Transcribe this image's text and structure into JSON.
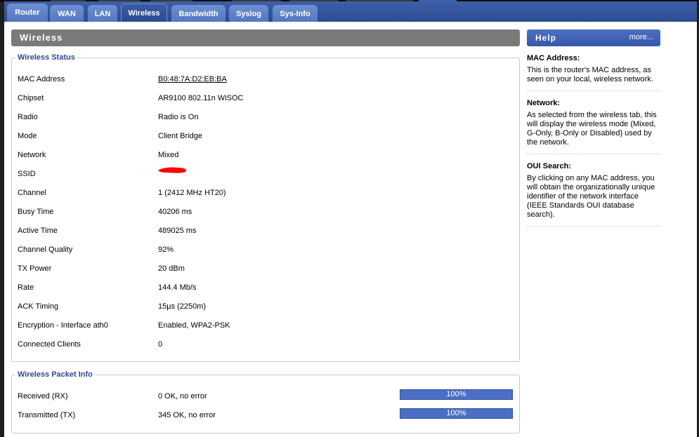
{
  "tabs": [
    {
      "label": "Router"
    },
    {
      "label": "WAN"
    },
    {
      "label": "LAN"
    },
    {
      "label": "Wireless"
    },
    {
      "label": "Bandwidth"
    },
    {
      "label": "Syslog"
    },
    {
      "label": "Sys-Info"
    }
  ],
  "section_title": "Wireless",
  "wireless_status": {
    "legend": "Wireless Status",
    "rows": [
      {
        "label": "MAC Address",
        "value": "B0:48:7A:D2:EB:BA"
      },
      {
        "label": "Chipset",
        "value": "AR9100 802.11n WiSOC"
      },
      {
        "label": "Radio",
        "value": "Radio is On"
      },
      {
        "label": "Mode",
        "value": "Client Bridge"
      },
      {
        "label": "Network",
        "value": "Mixed"
      },
      {
        "label": "SSID",
        "value": ""
      },
      {
        "label": "Channel",
        "value": "1 (2412 MHz HT20)"
      },
      {
        "label": "Busy Time",
        "value": "40206 ms"
      },
      {
        "label": "Active Time",
        "value": "489025 ms"
      },
      {
        "label": "Channel Quality",
        "value": "92%"
      },
      {
        "label": "TX Power",
        "value": "20 dBm"
      },
      {
        "label": "Rate",
        "value": "144.4 Mb/s"
      },
      {
        "label": "ACK Timing",
        "value": "15µs (2250m)"
      },
      {
        "label": "Encryption - Interface ath0",
        "value": "Enabled, WPA2-PSK"
      },
      {
        "label": "Connected Clients",
        "value": "0"
      }
    ]
  },
  "packet_info": {
    "legend": "Wireless Packet Info",
    "rows": [
      {
        "label": "Received (RX)",
        "value": "0 OK, no error",
        "bar": "100%",
        "bar_level": 1.0
      },
      {
        "label": "Transmitted (TX)",
        "value": "345 OK, no error",
        "bar": "100%",
        "bar_level": 1.0
      }
    ]
  },
  "help": {
    "title": "Help",
    "more": "more...",
    "items": [
      {
        "heading": "MAC Address:",
        "text": "This is the router's MAC address, as seen on your local, wireless network."
      },
      {
        "heading": "Network:",
        "text": "As selected from the wireless tab, this will display the wireless mode (Mixed, G-Only, B-Only or Disabled) used by the network."
      },
      {
        "heading": "OUI Search:",
        "text": "By clicking on any MAC address, you will obtain the organizationally unique identifier of the network interface (IEEE Standards OUI database search)."
      }
    ]
  },
  "colors": {
    "accent": "#2b4a90",
    "tab": "#5177c1",
    "bar": "#4a6fc4",
    "redaction": "#ff0000"
  }
}
